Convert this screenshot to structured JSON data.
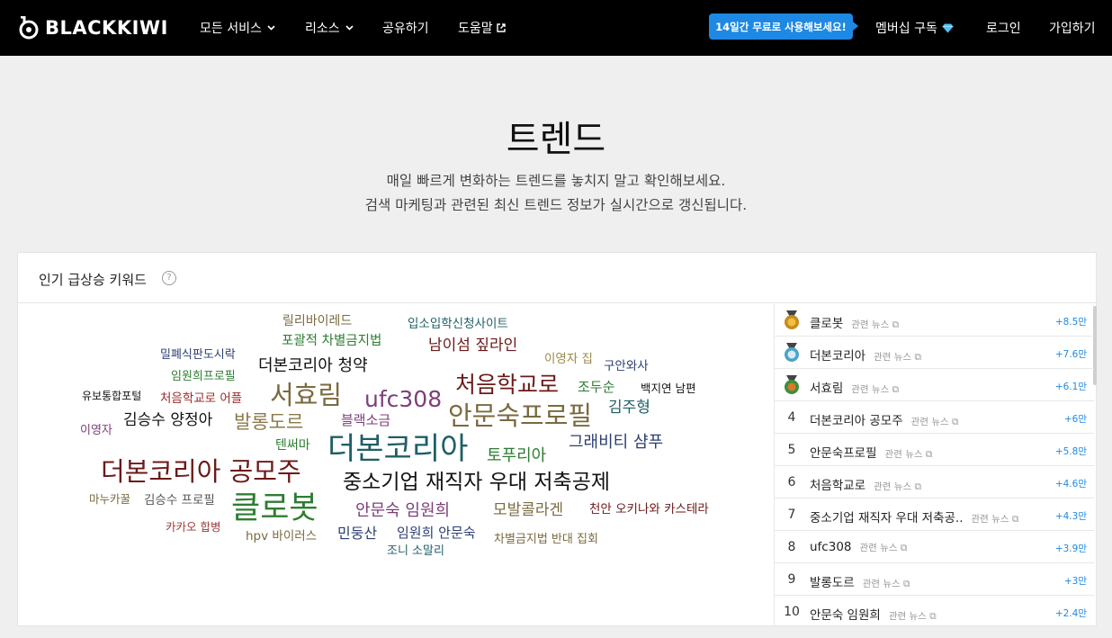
{
  "nav": {
    "logo": "BLACKKIWI",
    "items": [
      "모든 서비스",
      "리소스",
      "공유하기",
      "도움말"
    ],
    "promo": "14일간 무료로 사용해보세요!",
    "membership": "멤버십 구독",
    "login": "로그인",
    "signup": "가입하기"
  },
  "hero": {
    "title": "트렌드",
    "line1": "매일 빠르게 변화하는 트렌드를 놓치지 말고 확인해보세요.",
    "line2": "검색 마케팅과 관련된 최신 트렌드 정보가 실시간으로 갱신됩니다."
  },
  "card": {
    "title": "인기 급상승 키워드",
    "help": "?"
  },
  "colors": {
    "accent": "#1e88e5",
    "maroon": "#6b1a1a",
    "olive": "#7a6a3f",
    "green": "#2e7d32",
    "navy": "#2c3e73",
    "teal": "#1f5f66",
    "purple": "#7b3f7a",
    "red": "#9b2a2a"
  },
  "cloud": [
    {
      "text": "릴리바이레드"
    },
    {
      "text": "입소입학신청사이트"
    },
    {
      "text": "포괄적 차별금지법"
    },
    {
      "text": "남이섬 짚라인"
    },
    {
      "text": "밀폐식판도시락"
    },
    {
      "text": "이영자 집"
    },
    {
      "text": "더본코리아 청약"
    },
    {
      "text": "구안와사"
    },
    {
      "text": "임원희프로필"
    },
    {
      "text": "처음학교로"
    },
    {
      "text": "조두순"
    },
    {
      "text": "백지연 남편"
    },
    {
      "text": "서효림"
    },
    {
      "text": "ufc308"
    },
    {
      "text": "유보통합포털"
    },
    {
      "text": "처음학교로 어플"
    },
    {
      "text": "김주형"
    },
    {
      "text": "안문숙프로필"
    },
    {
      "text": "김승수 양정아"
    },
    {
      "text": "발롱도르"
    },
    {
      "text": "블랙소금"
    },
    {
      "text": "이영자"
    },
    {
      "text": "그래비티 샴푸"
    },
    {
      "text": "텐써마"
    },
    {
      "text": "더본코리아"
    },
    {
      "text": "토푸리아"
    },
    {
      "text": "더본코리아 공모주"
    },
    {
      "text": "중소기업 재직자 우대 저축공제"
    },
    {
      "text": "마누카꿀"
    },
    {
      "text": "김승수 프로필"
    },
    {
      "text": "클로봇"
    },
    {
      "text": "안문숙 임원희"
    },
    {
      "text": "모발콜라겐"
    },
    {
      "text": "천안 오키나와 카스테라"
    },
    {
      "text": "카카오 합병"
    },
    {
      "text": "hpv 바이러스"
    },
    {
      "text": "민둥산"
    },
    {
      "text": "임원희 안문숙"
    },
    {
      "text": "차별금지법 반대 집회"
    },
    {
      "text": "조니 소말리"
    }
  ],
  "ranking": [
    {
      "rank": "1",
      "medal": "gold",
      "keyword": "클로봇",
      "news": "관련 뉴스",
      "change": "+8.5만"
    },
    {
      "rank": "2",
      "medal": "silver",
      "keyword": "더본코리아",
      "news": "관련 뉴스",
      "change": "+7.6만"
    },
    {
      "rank": "3",
      "medal": "bronze",
      "keyword": "서효림",
      "news": "관련 뉴스",
      "change": "+6.1만"
    },
    {
      "rank": "4",
      "keyword": "더본코리아 공모주",
      "news": "관련 뉴스",
      "change": "+6만"
    },
    {
      "rank": "5",
      "keyword": "안문숙프로필",
      "news": "관련 뉴스",
      "change": "+5.8만"
    },
    {
      "rank": "6",
      "keyword": "처음학교로",
      "news": "관련 뉴스",
      "change": "+4.6만"
    },
    {
      "rank": "7",
      "keyword": "중소기업 재직자 우대 저축공..",
      "news": "관련 뉴스",
      "change": "+4.3만"
    },
    {
      "rank": "8",
      "keyword": "ufc308",
      "news": "관련 뉴스",
      "change": "+3.9만"
    },
    {
      "rank": "9",
      "keyword": "발롱도르",
      "news": "관련 뉴스",
      "change": "+3만"
    },
    {
      "rank": "10",
      "keyword": "안문숙 임원희",
      "news": "관련 뉴스",
      "change": "+2.4만"
    }
  ]
}
